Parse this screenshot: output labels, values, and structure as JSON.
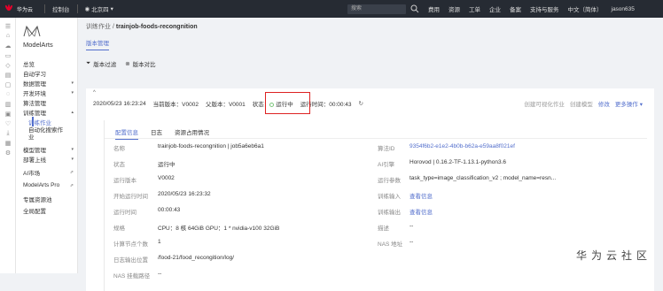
{
  "topbar": {
    "brand": "华为云",
    "console": "控制台",
    "region": "北京四",
    "search_placeholder": "搜索",
    "menu": [
      "费用",
      "资源",
      "工单",
      "企业",
      "备案",
      "支持与服务",
      "中文（简体）",
      "jason635"
    ]
  },
  "sidebar": {
    "product": "ModelArts",
    "items": [
      {
        "label": "总览",
        "arrow": ""
      },
      {
        "label": "自动学习",
        "arrow": ""
      },
      {
        "label": "数据管理",
        "arrow": "▾"
      },
      {
        "label": "开发环境",
        "arrow": "▾"
      },
      {
        "label": "算法管理",
        "arrow": ""
      },
      {
        "label": "训练管理",
        "arrow": "▴"
      },
      {
        "label": "训练作业",
        "arrow": ""
      },
      {
        "label": "自动化搜索作业",
        "arrow": ""
      },
      {
        "label": "模型管理",
        "arrow": "▾"
      },
      {
        "label": "部署上线",
        "arrow": "▾"
      },
      {
        "label": "AI市场",
        "arrow": "⇗"
      },
      {
        "label": "ModelArts Pro",
        "arrow": "⇗"
      },
      {
        "label": "专属资源池",
        "arrow": ""
      },
      {
        "label": "全局配置",
        "arrow": ""
      }
    ]
  },
  "breadcrumb": {
    "parent": "训练作业",
    "sep": "/",
    "current": "trainjob-foods-recongnition"
  },
  "page_tab": "版本管理",
  "toolbar": {
    "filter": "版本过滤",
    "compare": "版本对比"
  },
  "version_header": {
    "time": "2020/05/23 16:23:24",
    "current_version": "当前版本：V0002",
    "parent_version": "父版本：V0001",
    "status_label": "状态：",
    "status_value": "运行中",
    "run_time": "运行时间：00:00:43",
    "actions": [
      "创建可视化作业",
      "创建模型",
      "修改",
      "更多操作 ▾"
    ]
  },
  "inner_tabs": [
    "配置信息",
    "日志",
    "资源占用情况"
  ],
  "details_left": [
    {
      "label": "名称",
      "value": "trainjob-foods-recongnition | job5a6eb6a1"
    },
    {
      "label": "状态",
      "value": "运行中"
    },
    {
      "label": "运行版本",
      "value": "V0002"
    },
    {
      "label": "开始运行时间",
      "value": "2020/05/23 16:23:32"
    },
    {
      "label": "运行时间",
      "value": "00:00:43"
    },
    {
      "label": "规格",
      "value": "CPU：8 核 64GiB GPU：1 * nvidia-v100 32GiB"
    },
    {
      "label": "计算节点个数",
      "value": "1"
    },
    {
      "label": "日志输出位置",
      "value": "/food-21/food_recongition/log/"
    },
    {
      "label": "NAS 挂载路径",
      "value": "--"
    }
  ],
  "details_right": [
    {
      "label": "算法ID",
      "value": "9354f6b2-e1e2-4b0b-b62a-e59aa8f021ef",
      "link": true
    },
    {
      "label": "AI引擎",
      "value": "Horovod | 0.16.2-TF-1.13.1-python3.6",
      "link": false
    },
    {
      "label": "运行参数",
      "value": "task_type=image_classification_v2 ; model_name=resn...",
      "link": false
    },
    {
      "label": "训练输入",
      "value": "查看信息",
      "link": true
    },
    {
      "label": "训练输出",
      "value": "查看信息",
      "link": true
    },
    {
      "label": "描述",
      "value": "--",
      "link": false
    },
    {
      "label": "NAS 地址",
      "value": "--",
      "link": false
    }
  ],
  "watermark": "华为云社区",
  "colors": {
    "accent": "#526ecc",
    "topbar": "#262b33",
    "highlight_box": "#dd2222"
  }
}
